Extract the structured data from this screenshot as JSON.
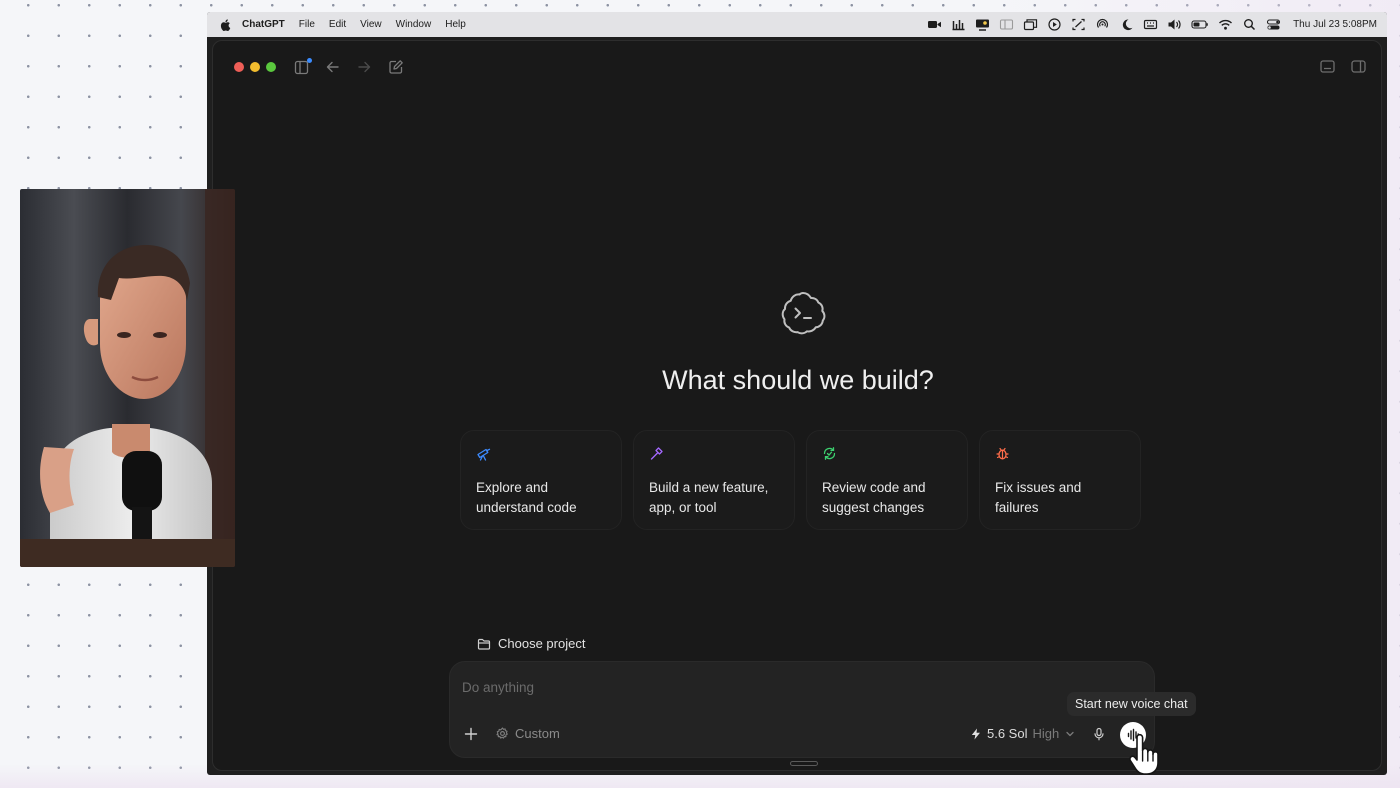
{
  "menubar": {
    "app_name": "ChatGPT",
    "menus": [
      "File",
      "Edit",
      "View",
      "Window",
      "Help"
    ],
    "clock": "Thu Jul 23  5:08PM"
  },
  "main": {
    "title": "What should we build?",
    "cards": [
      {
        "label": "Explore and understand code",
        "icon": "telescope-icon",
        "color": "#3d8bff"
      },
      {
        "label": "Build a new feature, app, or tool",
        "icon": "hammer-icon",
        "color": "#a468ff"
      },
      {
        "label": "Review code and suggest changes",
        "icon": "refresh-check-icon",
        "color": "#3ccf6e"
      },
      {
        "label": "Fix issues and failures",
        "icon": "bug-icon",
        "color": "#ff6d4a"
      }
    ]
  },
  "composer": {
    "project_label": "Choose project",
    "placeholder": "Do anything",
    "mode_label": "Custom",
    "model_name": "5.6 Sol",
    "effort": "High"
  },
  "tooltip": {
    "text": "Start new voice chat"
  },
  "colors": {
    "accent_blue": "#3b8cff",
    "window_bg": "#191919"
  }
}
